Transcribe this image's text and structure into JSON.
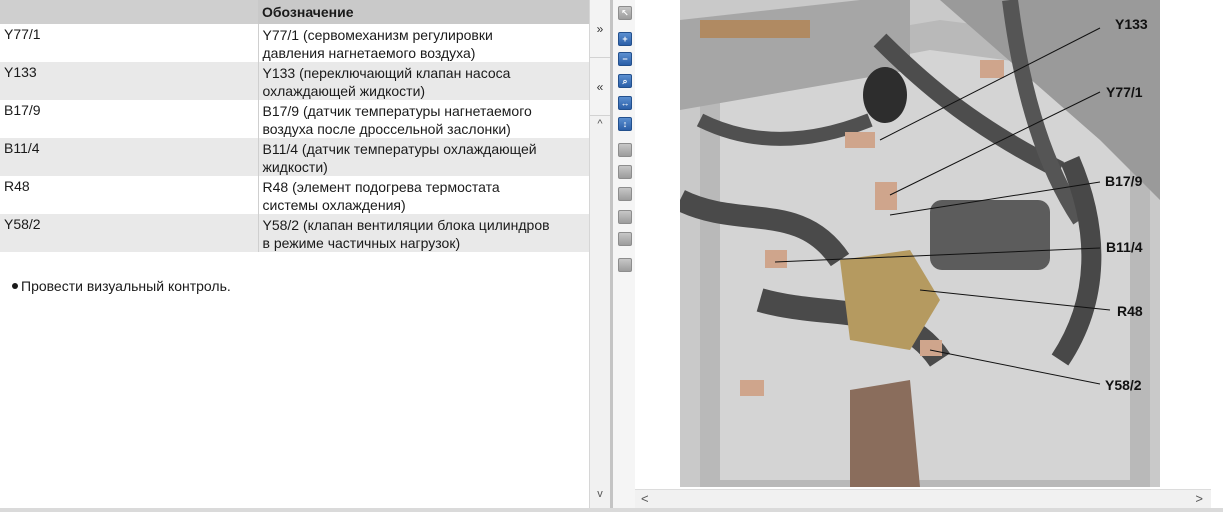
{
  "table": {
    "header": {
      "col1": "",
      "col2": "Обозначение"
    },
    "rows": [
      {
        "code": "Y77/1",
        "desc_line1": "Y77/1 (сервомеханизм регулировки",
        "desc_line2": "давления нагнетаемого воздуха)"
      },
      {
        "code": "Y133",
        "desc_line1": "Y133 (переключающий клапан насоса",
        "desc_line2": "охлаждающей жидкости)"
      },
      {
        "code": "B17/9",
        "desc_line1": "B17/9 (датчик температуры нагнетаемого",
        "desc_line2": "воздуха после дроссельной заслонки)"
      },
      {
        "code": "B11/4",
        "desc_line1": "B11/4 (датчик температуры охлаждающей",
        "desc_line2": "жидкости)"
      },
      {
        "code": "R48",
        "desc_line1": "R48 (элемент подогрева термостата",
        "desc_line2": "системы охлаждения)"
      },
      {
        "code": "Y58/2",
        "desc_line1": "Y58/2 (клапан вентиляции блока цилиндров",
        "desc_line2": "в режиме частичных нагрузок)"
      }
    ]
  },
  "instruction": "Провести визуальный контроль.",
  "scroll": {
    "expand_glyph": "»",
    "collapse_glyph": "«",
    "up": "^",
    "down": "v",
    "left": "<",
    "right": ">"
  },
  "callouts": [
    "Y133",
    "Y77/1",
    "B17/9",
    "B11/4",
    "R48",
    "Y58/2"
  ],
  "colors": {
    "header_bg": "#c9c9c9",
    "row_alt": "#e9e9e9",
    "toolbar_blue": "#3a6fb8"
  }
}
